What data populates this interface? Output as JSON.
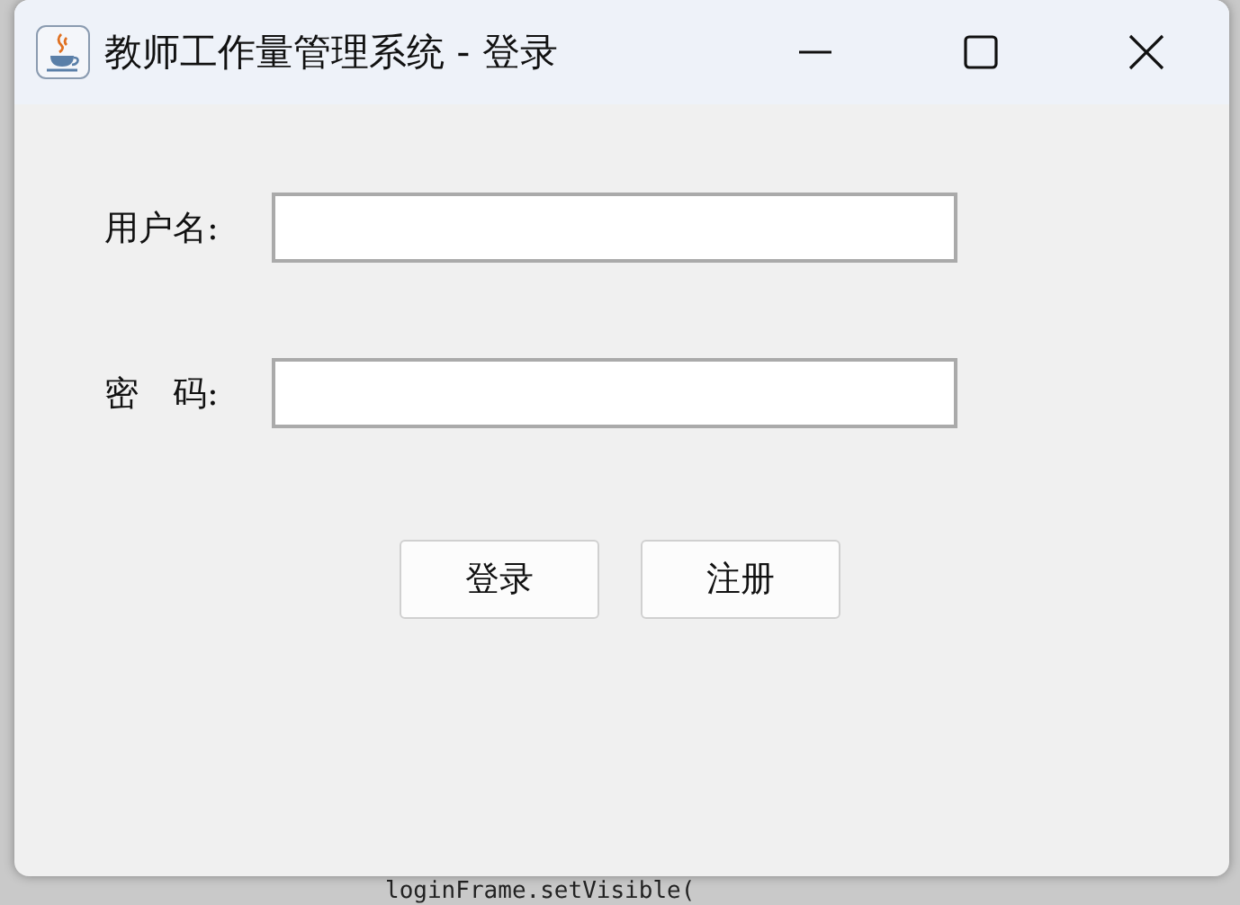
{
  "window": {
    "title": "教师工作量管理系统 - 登录"
  },
  "fields": [
    {
      "label": "用户名:"
    },
    {
      "label": "密　码:"
    }
  ],
  "buttons": [
    "登录",
    "注册"
  ],
  "background_editor": {
    "code_line": "loginFrame.setVisible("
  }
}
